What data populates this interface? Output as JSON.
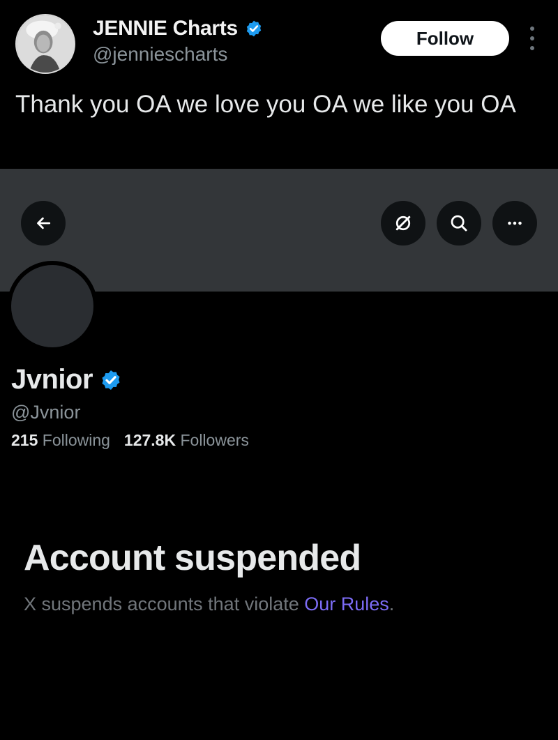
{
  "tweet": {
    "author_name": "JENNIE Charts",
    "author_handle": "@jenniescharts",
    "follow_label": "Follow",
    "text": "Thank you OA we love you OA we like you OA"
  },
  "header": {
    "back_icon": "arrow-left-icon",
    "grok_icon": "grok-icon",
    "search_icon": "search-icon",
    "more_icon": "more-horizontal-icon"
  },
  "profile": {
    "name": "Jvnior",
    "handle": "@Jvnior",
    "following_count": "215",
    "following_label": "Following",
    "followers_count": "127.8K",
    "followers_label": "Followers"
  },
  "suspension": {
    "title": "Account suspended",
    "description_prefix": "X suspends accounts that violate ",
    "rules_link": "Our Rules",
    "description_suffix": "."
  },
  "colors": {
    "background": "#000000",
    "banner": "#333639",
    "verified_blue": "#1d9bf0",
    "link_purple": "#7c6cf5",
    "muted_text": "#71767b"
  }
}
